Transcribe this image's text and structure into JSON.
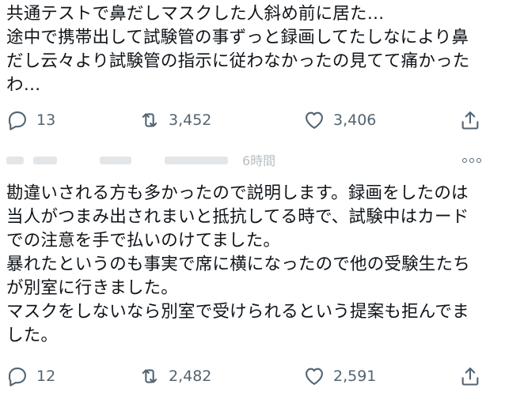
{
  "tweet1": {
    "lines": [
      "共通テストで鼻だしマスクした人斜め前に居た…",
      "途中で携帯出して試験管の事ずっと録画してたしなにより鼻",
      "だし云々より試験管の指示に従わなかったの見てて痛かった",
      "わ…"
    ],
    "reply_count": "13",
    "retweet_count": "3,452",
    "like_count": "3,406"
  },
  "tweet2": {
    "header_time": "6時間",
    "lines": [
      "勘違いされる方も多かったので説明します。録画をしたのは",
      "当人がつまみ出されまいと抵抗してる時で、試験中はカード",
      "での注意を手で払いのけてました。",
      "暴れたというのも事実で席に横になったので他の受験生たち",
      "が別室に行きました。",
      "マスクをしないなら別室で受けられるという提案も拒んでま",
      "した。"
    ],
    "reply_count": "12",
    "retweet_count": "2,482",
    "like_count": "2,591"
  },
  "icons": {
    "reply": "reply-icon",
    "retweet": "retweet-icon",
    "like": "heart-icon",
    "share": "share-icon",
    "more": "more-icon"
  },
  "colors": {
    "text": "#0f1419",
    "secondary": "#536471"
  }
}
